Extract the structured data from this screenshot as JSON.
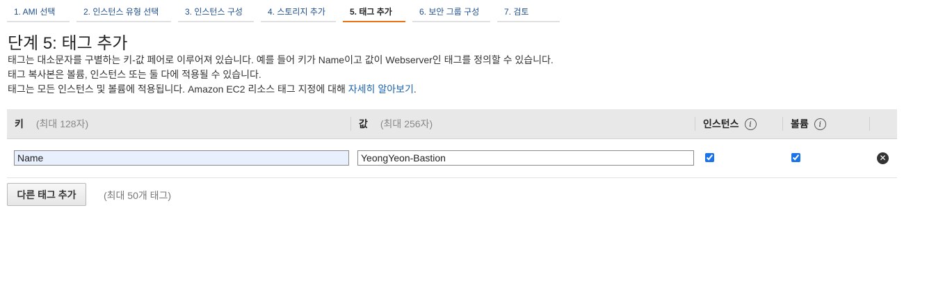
{
  "steps": [
    {
      "label": "1. AMI 선택",
      "active": false
    },
    {
      "label": "2. 인스턴스 유형 선택",
      "active": false
    },
    {
      "label": "3. 인스턴스 구성",
      "active": false
    },
    {
      "label": "4. 스토리지 추가",
      "active": false
    },
    {
      "label": "5. 태그 추가",
      "active": true
    },
    {
      "label": "6. 보안 그룹 구성",
      "active": false
    },
    {
      "label": "7. 검토",
      "active": false
    }
  ],
  "page": {
    "title": "단계 5: 태그 추가",
    "desc1": "태그는 대소문자를 구별하는 키-값 페어로 이루어져 있습니다. 예를 들어 키가 Name이고 값이 Webserver인 태그를 정의할 수 있습니다.",
    "desc2": "태그 복사본은 볼륨, 인스턴스 또는 둘 다에 적용될 수 있습니다.",
    "desc3_prefix": "태그는 모든 인스턴스 및 볼륨에 적용됩니다. Amazon EC2 리소스 태그 지정에 대해 ",
    "desc3_link": "자세히 알아보기",
    "desc3_suffix": "."
  },
  "table": {
    "key_header": "키",
    "key_hint": "(최대 128자)",
    "value_header": "값",
    "value_hint": "(최대 256자)",
    "instances_header": "인스턴스",
    "volumes_header": "볼륨",
    "info_icon_glyph": "i",
    "rows": [
      {
        "key": "Name",
        "value": "YeongYeon-Bastion",
        "instances": true,
        "volumes": true,
        "remove_glyph": "✕"
      }
    ]
  },
  "actions": {
    "add_tag_label": "다른 태그 추가",
    "max_tags_note": "(최대 50개 태그)"
  },
  "colors": {
    "accent": "#ec7211",
    "link": "#1a62b0",
    "header_bg": "#e8e8e8"
  }
}
